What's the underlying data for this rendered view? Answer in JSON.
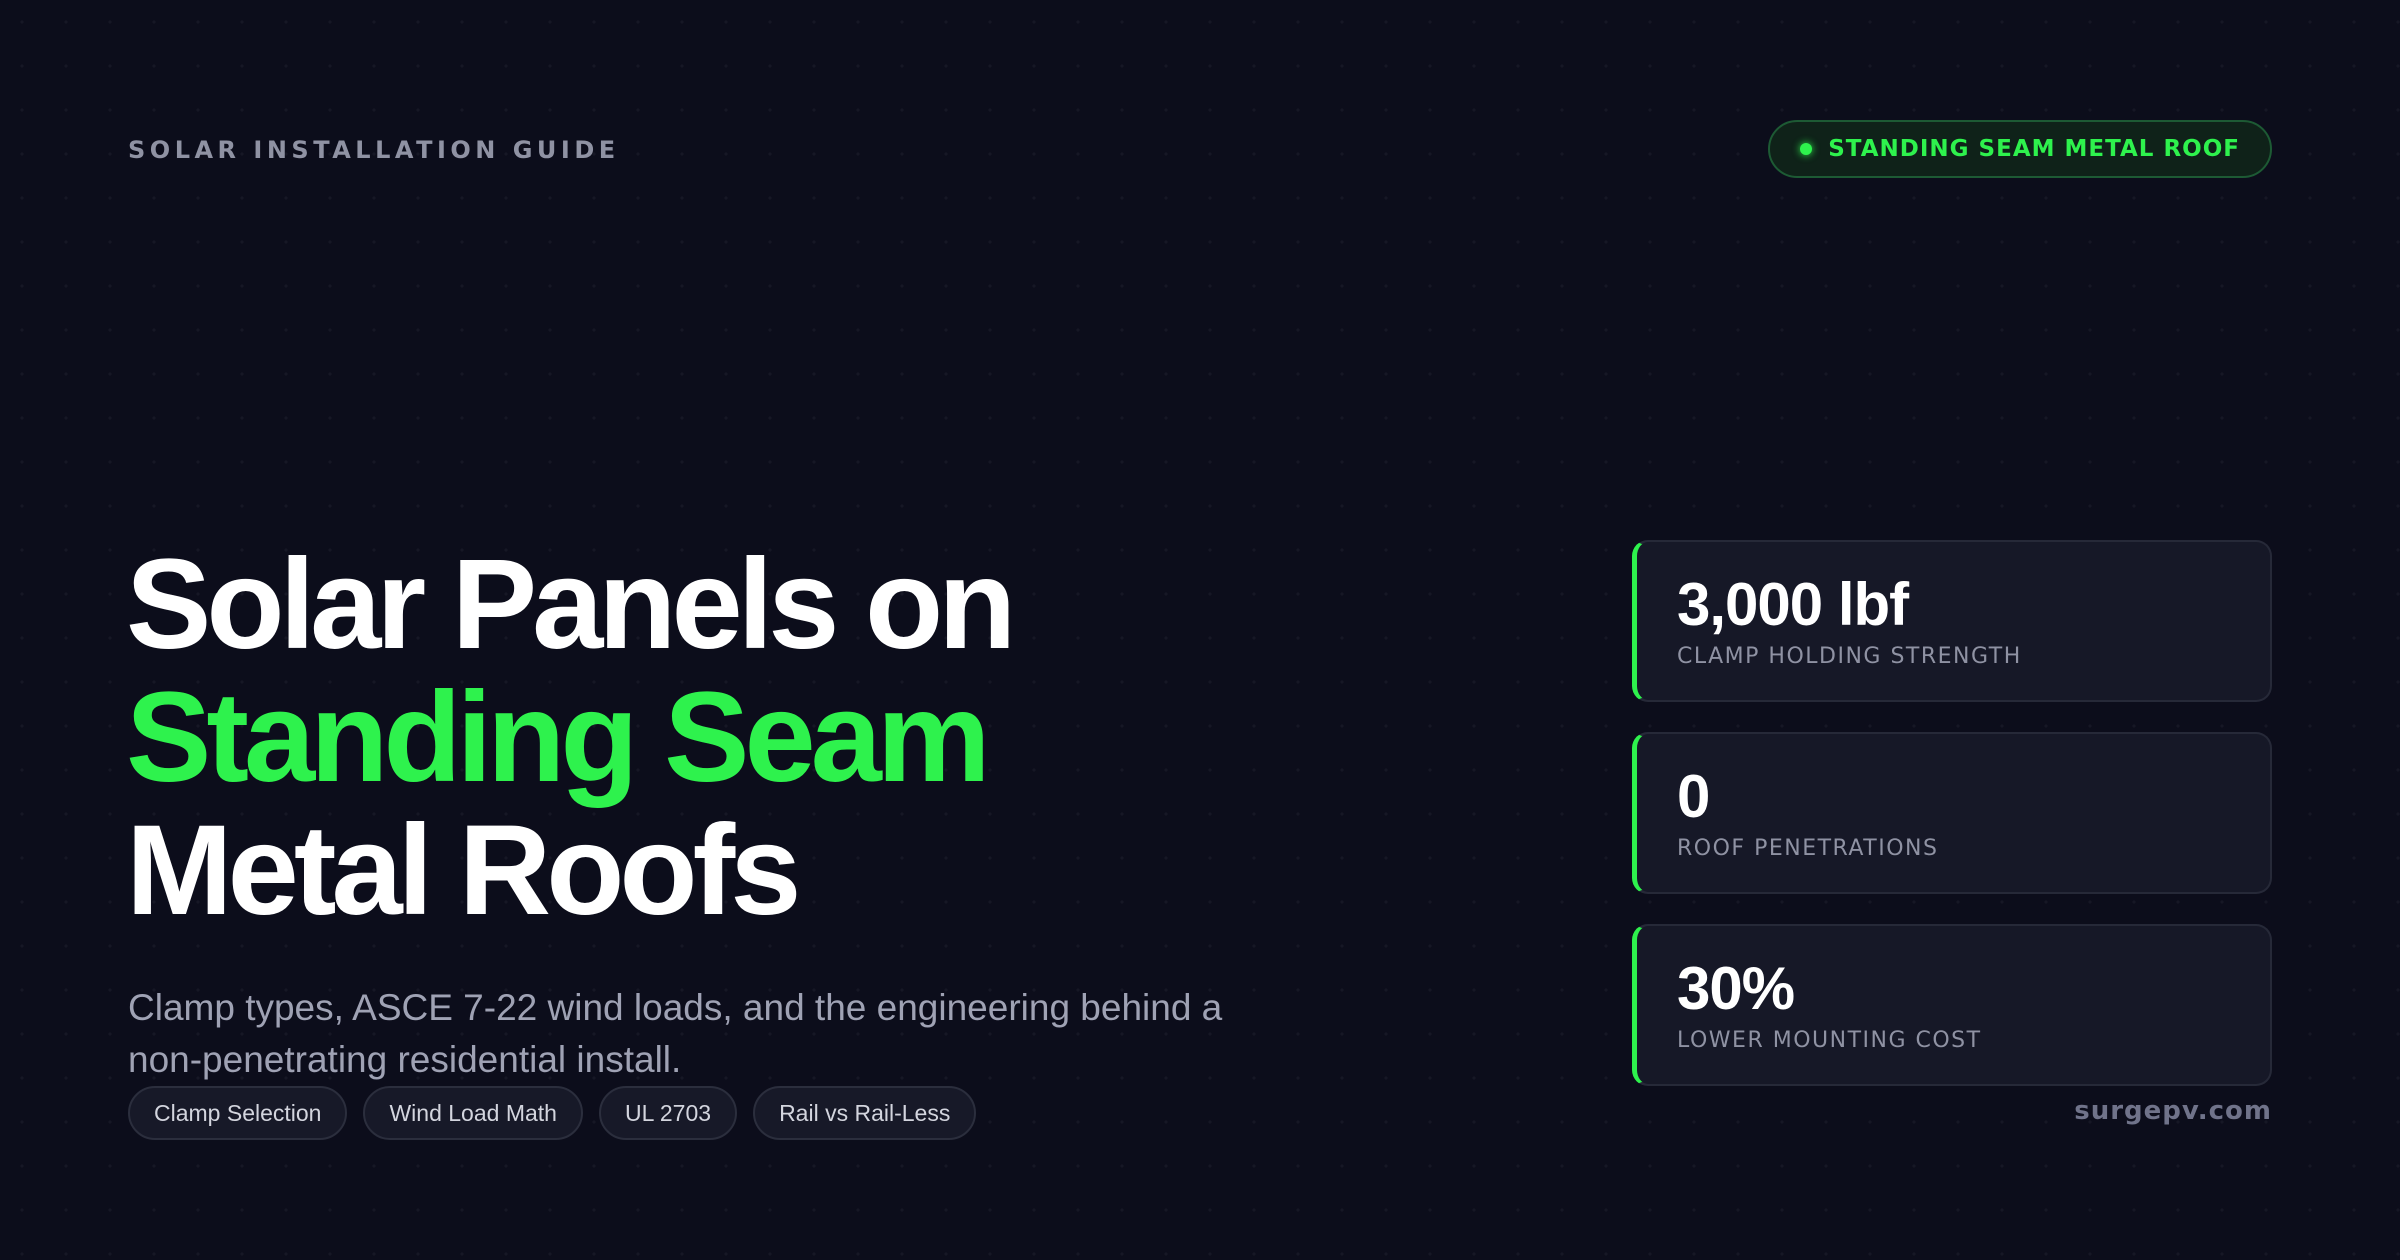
{
  "header": {
    "eyebrow": "SOLAR INSTALLATION GUIDE",
    "badge": "STANDING SEAM METAL ROOF"
  },
  "headline": {
    "line1": "Solar Panels on",
    "line2": "Standing Seam",
    "line3": "Metal Roofs"
  },
  "subtitle": "Clamp types, ASCE 7-22 wind loads, and the engineering behind a non-penetrating residential install.",
  "tags": [
    "Clamp Selection",
    "Wind Load Math",
    "UL 2703",
    "Rail vs Rail-Less"
  ],
  "stats": [
    {
      "value": "3,000 lbf",
      "label": "CLAMP HOLDING STRENGTH"
    },
    {
      "value": "0",
      "label": "ROOF PENETRATIONS"
    },
    {
      "value": "30%",
      "label": "LOWER MOUNTING COST"
    }
  ],
  "footer": {
    "site": "surgepv.com"
  },
  "colors": {
    "background": "#0c0d1b",
    "accent": "#2ef24d",
    "muted_text": "#8f92a3",
    "card_background": "#161827"
  },
  "icons": {
    "badge_indicator": "status-dot-icon"
  }
}
